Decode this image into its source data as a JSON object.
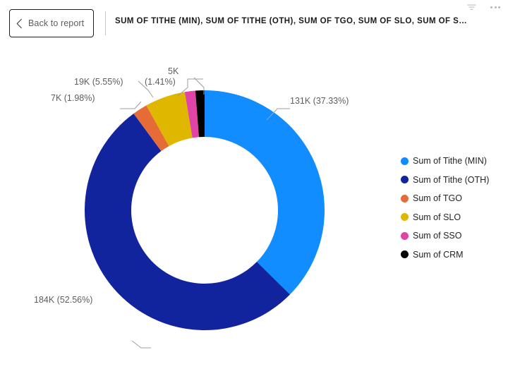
{
  "topbar": {
    "back_label": "Back to report",
    "back_icon": "chevron-left-icon",
    "report_title": "SUM OF TITHE (MIN), SUM OF TITHE (OTH), SUM OF TGO, SUM OF SLO, SUM OF SSO AND SU...",
    "filter_icon": "filter-icon",
    "more_icon": "more-options-icon"
  },
  "chart_data": {
    "type": "pie",
    "variant": "donut",
    "title": "SUM OF TITHE (MIN), SUM OF TITHE (OTH), SUM OF TGO, SUM OF SLO, SUM OF SSO AND SU...",
    "legend_position": "right",
    "categories": [
      "Sum of Tithe (MIN)",
      "Sum of Tithe (OTH)",
      "Sum of TGO",
      "Sum of SLO",
      "Sum of SSO",
      "Sum of CRM"
    ],
    "values": [
      131000,
      184000,
      7000,
      19000,
      5000,
      4300
    ],
    "percentages": [
      37.33,
      52.56,
      1.98,
      5.55,
      1.41,
      1.23
    ],
    "colors": [
      "#118DFF",
      "#12239E",
      "#E66C37",
      "#DFB600",
      "#E044A7",
      "#000000"
    ],
    "data_labels": [
      "131K (37.33%)",
      "184K (52.56%)",
      "7K (1.98%)",
      "19K (5.55%)",
      "(1.41%)",
      "5K"
    ]
  },
  "legend": {
    "items": [
      {
        "label": "Sum of Tithe (MIN)",
        "color": "#118DFF"
      },
      {
        "label": "Sum of Tithe (OTH)",
        "color": "#12239E"
      },
      {
        "label": "Sum of TGO",
        "color": "#E66C37"
      },
      {
        "label": "Sum of SLO",
        "color": "#DFB600"
      },
      {
        "label": "Sum of SSO",
        "color": "#E044A7"
      },
      {
        "label": "Sum of CRM",
        "color": "#000000"
      }
    ]
  }
}
